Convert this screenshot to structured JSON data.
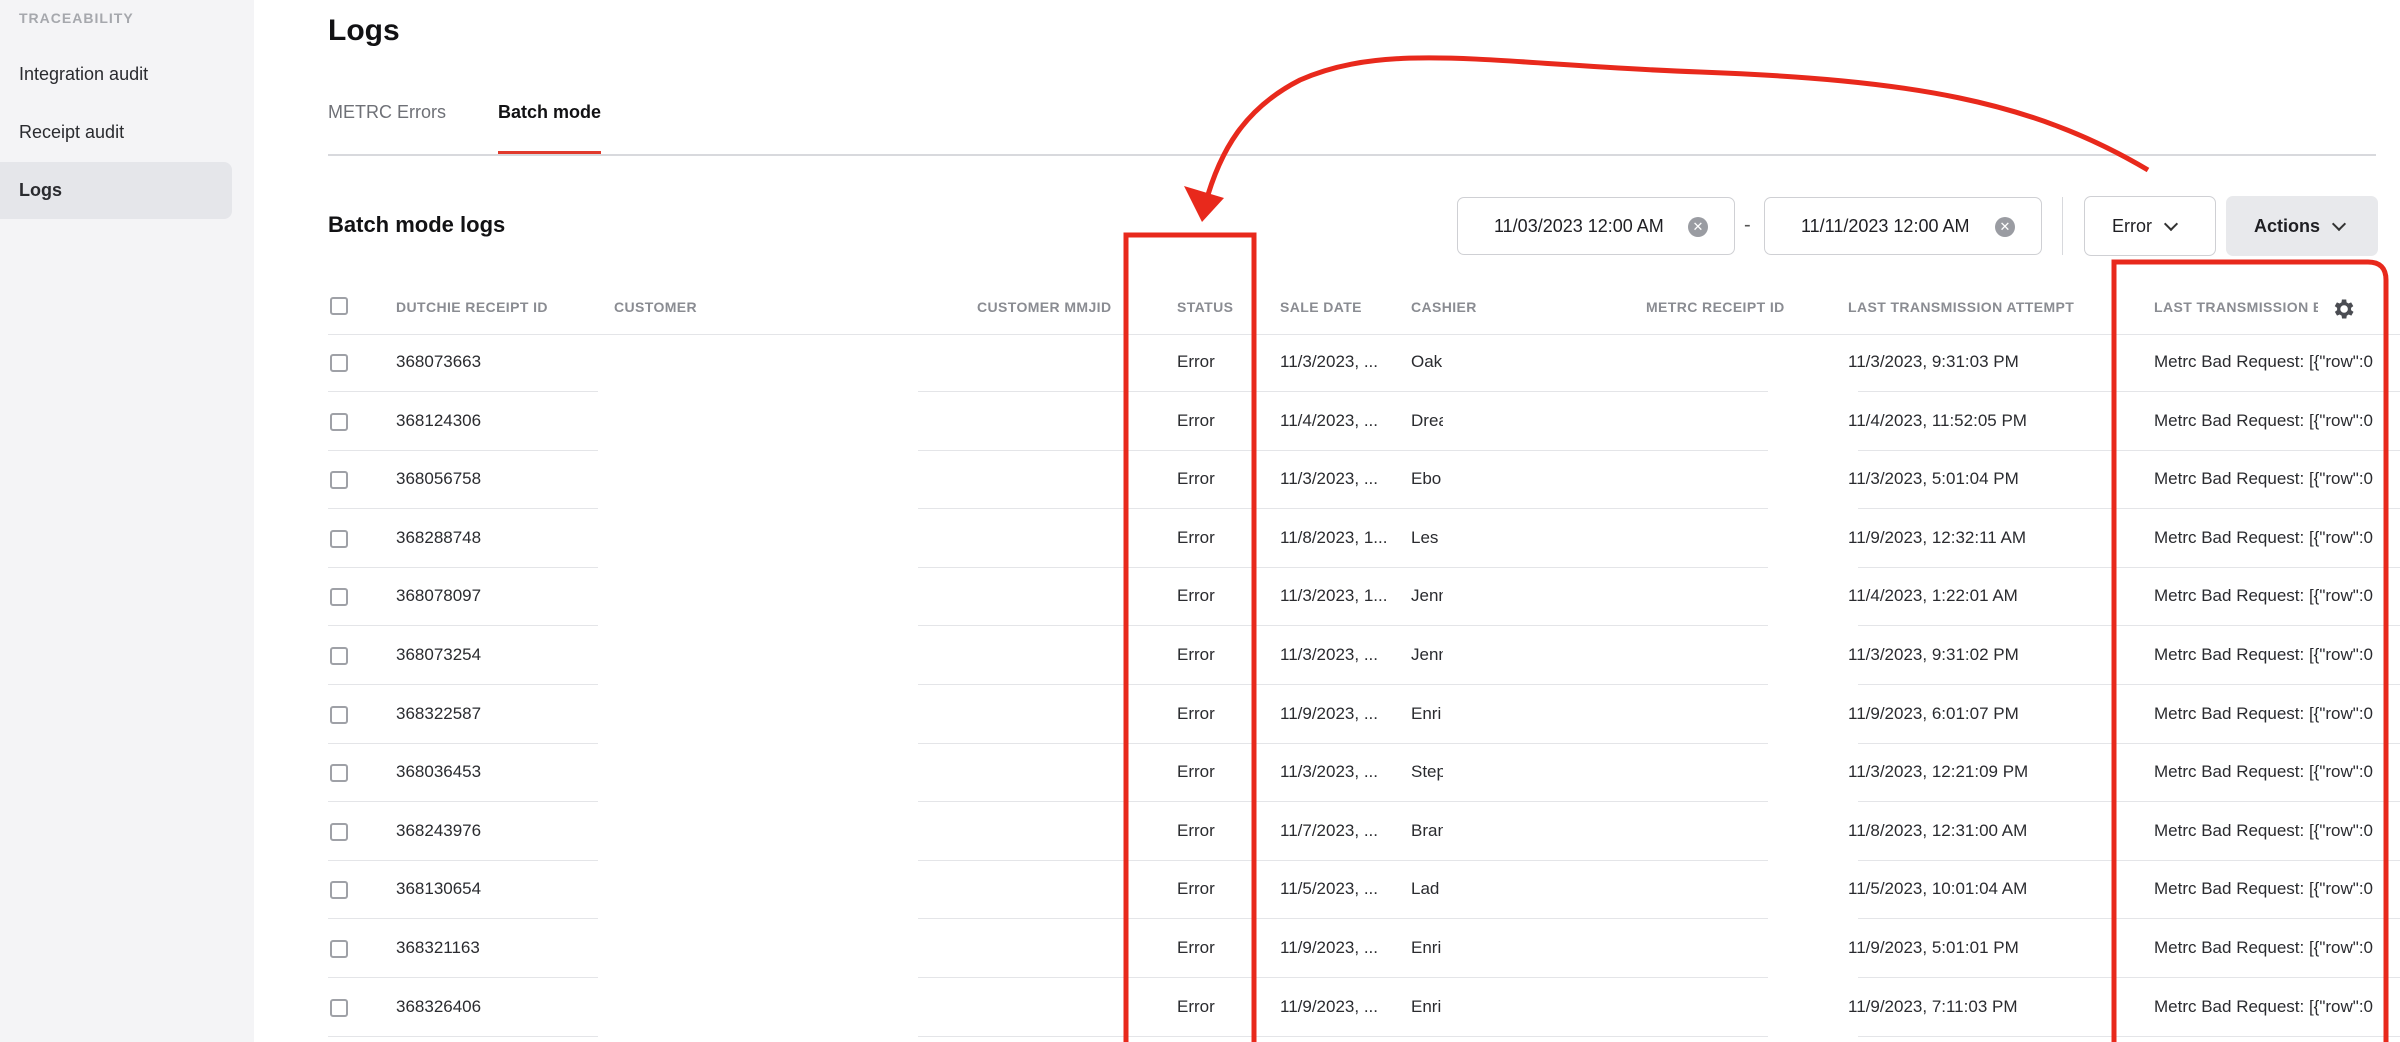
{
  "sidebar": {
    "section": "TRACEABILITY",
    "items": [
      {
        "label": "Integration audit"
      },
      {
        "label": "Receipt audit"
      },
      {
        "label": "Logs"
      }
    ]
  },
  "page": {
    "title": "Logs",
    "tabs": [
      {
        "label": "METRC Errors"
      },
      {
        "label": "Batch mode"
      }
    ],
    "section_title": "Batch mode logs"
  },
  "filters": {
    "start_date": "11/03/2023 12:00 AM",
    "end_date": "11/11/2023 12:00 AM",
    "separator": "-",
    "status_filter": "Error",
    "actions_label": "Actions"
  },
  "table": {
    "headers": {
      "receipt_id": "DUTCHIE RECEIPT ID",
      "customer": "CUSTOMER",
      "mmjid": "CUSTOMER MMJID",
      "status": "STATUS",
      "sale_date": "SALE DATE",
      "cashier": "CASHIER",
      "metrc_id": "METRC RECEIPT ID",
      "last_attempt": "LAST TRANSMISSION ATTEMPT",
      "last_error": "LAST TRANSMISSION E"
    },
    "rows": [
      {
        "id": "368073663",
        "status": "Error",
        "sale": "11/3/2023, ...",
        "cashier": "Oak",
        "attempt": "11/3/2023, 9:31:03 PM",
        "error": "Metrc Bad Request: [{\"row\":0"
      },
      {
        "id": "368124306",
        "status": "Error",
        "sale": "11/4/2023, ...",
        "cashier": "Drea",
        "attempt": "11/4/2023, 11:52:05 PM",
        "error": "Metrc Bad Request: [{\"row\":0"
      },
      {
        "id": "368056758",
        "status": "Error",
        "sale": "11/3/2023, ...",
        "cashier": "Ebo",
        "attempt": "11/3/2023, 5:01:04 PM",
        "error": "Metrc Bad Request: [{\"row\":0"
      },
      {
        "id": "368288748",
        "status": "Error",
        "sale": "11/8/2023, 1...",
        "cashier": "Les",
        "attempt": "11/9/2023, 12:32:11 AM",
        "error": "Metrc Bad Request: [{\"row\":0"
      },
      {
        "id": "368078097",
        "status": "Error",
        "sale": "11/3/2023, 1...",
        "cashier": "Jenn",
        "attempt": "11/4/2023, 1:22:01 AM",
        "error": "Metrc Bad Request: [{\"row\":0"
      },
      {
        "id": "368073254",
        "status": "Error",
        "sale": "11/3/2023, ...",
        "cashier": "Jenn",
        "attempt": "11/3/2023, 9:31:02 PM",
        "error": "Metrc Bad Request: [{\"row\":0"
      },
      {
        "id": "368322587",
        "status": "Error",
        "sale": "11/9/2023, ...",
        "cashier": "Enri",
        "attempt": "11/9/2023, 6:01:07 PM",
        "error": "Metrc Bad Request: [{\"row\":0"
      },
      {
        "id": "368036453",
        "status": "Error",
        "sale": "11/3/2023, ...",
        "cashier": "Step",
        "attempt": "11/3/2023, 12:21:09 PM",
        "error": "Metrc Bad Request: [{\"row\":0"
      },
      {
        "id": "368243976",
        "status": "Error",
        "sale": "11/7/2023, ...",
        "cashier": "Bran",
        "attempt": "11/8/2023, 12:31:00 AM",
        "error": "Metrc Bad Request: [{\"row\":0"
      },
      {
        "id": "368130654",
        "status": "Error",
        "sale": "11/5/2023, ...",
        "cashier": "Lad",
        "attempt": "11/5/2023, 10:01:04 AM",
        "error": "Metrc Bad Request: [{\"row\":0"
      },
      {
        "id": "368321163",
        "status": "Error",
        "sale": "11/9/2023, ...",
        "cashier": "Enri",
        "attempt": "11/9/2023, 5:01:01 PM",
        "error": "Metrc Bad Request: [{\"row\":0"
      },
      {
        "id": "368326406",
        "status": "Error",
        "sale": "11/9/2023, ...",
        "cashier": "Enri",
        "attempt": "11/9/2023, 7:11:03 PM",
        "error": "Metrc Bad Request: [{\"row\":0"
      }
    ]
  },
  "annotation": {
    "color": "#e8291c",
    "icons": [
      "highlight-box",
      "curved-arrow"
    ]
  }
}
